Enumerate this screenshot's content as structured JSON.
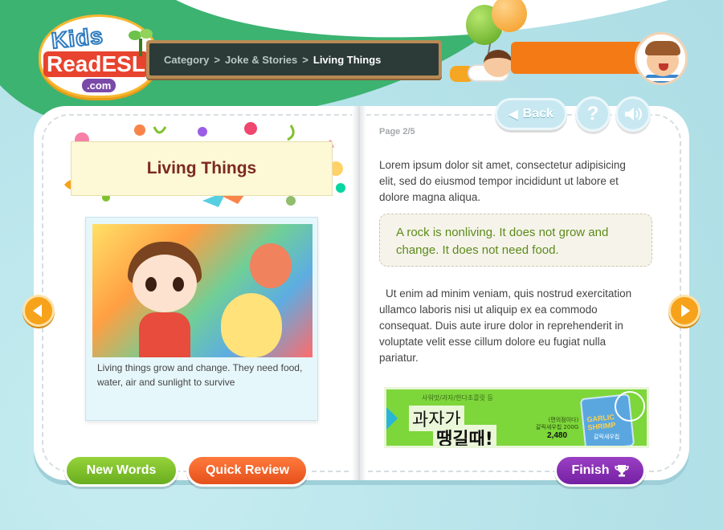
{
  "logo": {
    "line1": "Kids",
    "line2": "ReadESL",
    "line3": ".com"
  },
  "breadcrumb": {
    "items": [
      "Category",
      "Joke & Stories",
      "Living Things"
    ],
    "separator": ">"
  },
  "header": {
    "back_label": "Back",
    "help_label": "?"
  },
  "left_page": {
    "title": "Living Things",
    "caption": "Living things grow and change. They need food, water, air and sunlight to survive"
  },
  "right_page": {
    "page_indicator": "Page 2/5",
    "paragraph1": "Lorem ipsum dolor sit amet, consectetur adipisicing elit, sed do eiusmod tempor incididunt ut labore et dolore magna aliqua.",
    "highlight": "A rock is nonliving. It does not grow and change. It does not need food.",
    "paragraph2": "Ut enim ad minim veniam, quis nostrud exercitation ullamco laboris nisi ut aliquip ex ea commodo consequat. Duis aute irure dolor in reprehenderit in voluptate velit esse cillum dolore eu fugiat nulla pariatur."
  },
  "ad": {
    "tagline": "사워맛/과자/한다초콜릿 등",
    "headline1": "과자가",
    "headline2": "땡길때!",
    "product_label": "(편의점이다)\n갈릭새우칩 200G",
    "price": "2,480",
    "bag_text": "GARLIC\nSHRIMP",
    "bag_sub": "갈릭새우칩"
  },
  "footer": {
    "new_words_label": "New Words",
    "quick_review_label": "Quick Review",
    "finish_label": "Finish"
  },
  "icons": {
    "back": "arrow-left-icon",
    "help": "question-icon",
    "sound": "speaker-icon",
    "prev": "chevron-left-icon",
    "next": "chevron-right-icon",
    "finish": "trophy-icon"
  },
  "colors": {
    "new_words": "#7fc22b",
    "quick_review": "#f0621f",
    "finish": "#8a2fb8",
    "nav_arrow": "#f7a21b",
    "title_text": "#7b2a1f",
    "highlight_text": "#5c8a1c"
  }
}
